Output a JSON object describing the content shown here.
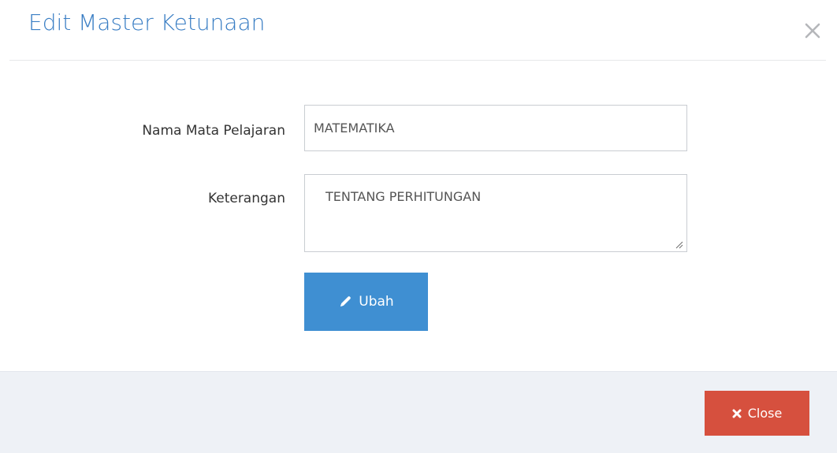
{
  "modal": {
    "title": "Edit Master Ketunaan",
    "close_icon": "close-x-icon"
  },
  "form": {
    "nama_label": "Nama Mata Pelajaran",
    "nama_value": "MATEMATIKA",
    "keterangan_label": "Keterangan",
    "keterangan_value": "TENTANG PERHITUNGAN",
    "submit": {
      "label": "Ubah",
      "icon": "pencil-icon",
      "color": "#3f8fd2"
    }
  },
  "footer": {
    "close": {
      "label": "Close",
      "icon": "times-icon",
      "color": "#d6503e"
    }
  },
  "colors": {
    "title": "#3a7ec4",
    "footer_bg": "#eef1f6"
  }
}
